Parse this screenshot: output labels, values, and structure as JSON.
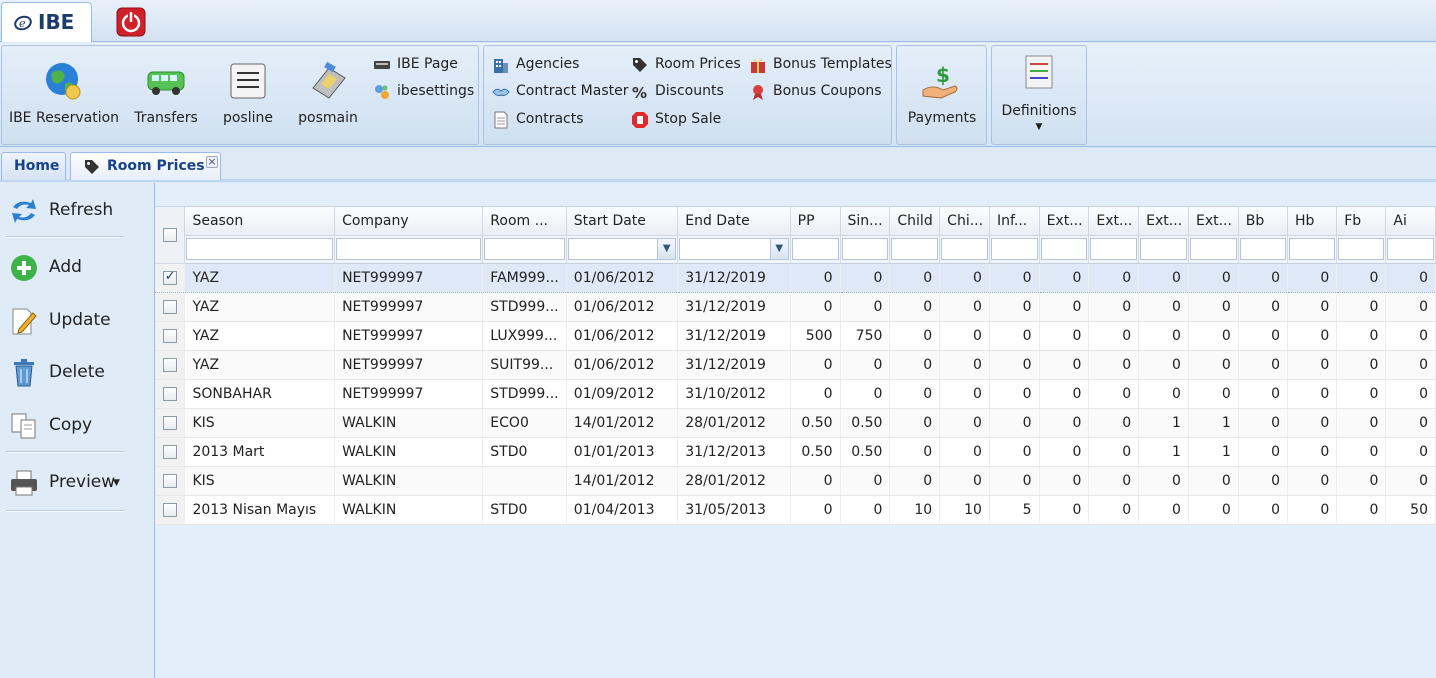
{
  "app": {
    "logo_text": "IBE",
    "logo_icon": "ibe-logo-icon",
    "power_icon": "power-off-icon",
    "power_color": "#d0202a"
  },
  "ribbon": {
    "group1": [
      {
        "label": "IBE Reservation",
        "icon": "globe-icon"
      },
      {
        "label": "Transfers",
        "icon": "van-icon"
      },
      {
        "label": "posline",
        "icon": "list-icon"
      },
      {
        "label": "posmain",
        "icon": "pos-terminal-icon"
      }
    ],
    "group1_small": [
      {
        "label": "IBE Page",
        "icon": "keyboard-icon"
      },
      {
        "label": "ibesettings",
        "icon": "settings-icon"
      }
    ],
    "group2_col1": [
      {
        "label": "Agencies",
        "icon": "building-icon"
      },
      {
        "label": "Contract Master",
        "icon": "handshake-icon"
      },
      {
        "label": "Contracts",
        "icon": "document-icon"
      }
    ],
    "group2_col2": [
      {
        "label": "Room Prices",
        "icon": "price-tag-icon"
      },
      {
        "label": "Discounts",
        "icon": "discount-icon"
      },
      {
        "label": "Stop Sale",
        "icon": "stop-icon"
      }
    ],
    "group2_col3": [
      {
        "label": "Bonus Templates",
        "icon": "gift-icon"
      },
      {
        "label": "Bonus Coupons",
        "icon": "ribbon-award-icon"
      }
    ],
    "payments": {
      "label": "Payments",
      "icon": "payment-icon"
    },
    "definitions": {
      "label": "Definitions",
      "icon": "checklist-icon"
    }
  },
  "tabs": {
    "home": "Home",
    "room_prices": "Room Prices",
    "close": "×"
  },
  "sidebar": {
    "refresh": "Refresh",
    "add": "Add",
    "update": "Update",
    "delete": "Delete",
    "copy": "Copy",
    "preview": "Preview"
  },
  "grid": {
    "columns": [
      "Season",
      "Company",
      "Room ...",
      "Start Date",
      "End Date",
      "PP",
      "Sin...",
      "Child",
      "Chi...",
      "Inf...",
      "Ext...",
      "Ext...",
      "Ext...",
      "Ext...",
      "Bb",
      "Hb",
      "Fb",
      "Ai"
    ],
    "rows": [
      {
        "checked": true,
        "cells": [
          "YAZ",
          "NET999997",
          "FAM999...",
          "01/06/2012",
          "31/12/2019",
          "0",
          "0",
          "0",
          "0",
          "0",
          "0",
          "0",
          "0",
          "0",
          "0",
          "0",
          "0",
          "0"
        ]
      },
      {
        "checked": false,
        "cells": [
          "YAZ",
          "NET999997",
          "STD999...",
          "01/06/2012",
          "31/12/2019",
          "0",
          "0",
          "0",
          "0",
          "0",
          "0",
          "0",
          "0",
          "0",
          "0",
          "0",
          "0",
          "0"
        ]
      },
      {
        "checked": false,
        "cells": [
          "YAZ",
          "NET999997",
          "LUX999...",
          "01/06/2012",
          "31/12/2019",
          "500",
          "750",
          "0",
          "0",
          "0",
          "0",
          "0",
          "0",
          "0",
          "0",
          "0",
          "0",
          "0"
        ]
      },
      {
        "checked": false,
        "cells": [
          "YAZ",
          "NET999997",
          "SUIT99...",
          "01/06/2012",
          "31/12/2019",
          "0",
          "0",
          "0",
          "0",
          "0",
          "0",
          "0",
          "0",
          "0",
          "0",
          "0",
          "0",
          "0"
        ]
      },
      {
        "checked": false,
        "cells": [
          "SONBAHAR",
          "NET999997",
          "STD999...",
          "01/09/2012",
          "31/10/2012",
          "0",
          "0",
          "0",
          "0",
          "0",
          "0",
          "0",
          "0",
          "0",
          "0",
          "0",
          "0",
          "0"
        ]
      },
      {
        "checked": false,
        "cells": [
          "KIS",
          "WALKIN",
          "ECO0",
          "14/01/2012",
          "28/01/2012",
          "0.50",
          "0.50",
          "0",
          "0",
          "0",
          "0",
          "0",
          "1",
          "1",
          "0",
          "0",
          "0",
          "0"
        ]
      },
      {
        "checked": false,
        "cells": [
          "2013 Mart",
          "WALKIN",
          "STD0",
          "01/01/2013",
          "31/12/2013",
          "0.50",
          "0.50",
          "0",
          "0",
          "0",
          "0",
          "0",
          "1",
          "1",
          "0",
          "0",
          "0",
          "0"
        ]
      },
      {
        "checked": false,
        "cells": [
          "KIS",
          "WALKIN",
          "",
          "14/01/2012",
          "28/01/2012",
          "0",
          "0",
          "0",
          "0",
          "0",
          "0",
          "0",
          "0",
          "0",
          "0",
          "0",
          "0",
          "0"
        ]
      },
      {
        "checked": false,
        "cells": [
          "2013 Nisan Mayıs",
          "WALKIN",
          "STD0",
          "01/04/2013",
          "31/05/2013",
          "0",
          "0",
          "10",
          "10",
          "5",
          "0",
          "0",
          "0",
          "0",
          "0",
          "0",
          "0",
          "50"
        ]
      }
    ]
  }
}
